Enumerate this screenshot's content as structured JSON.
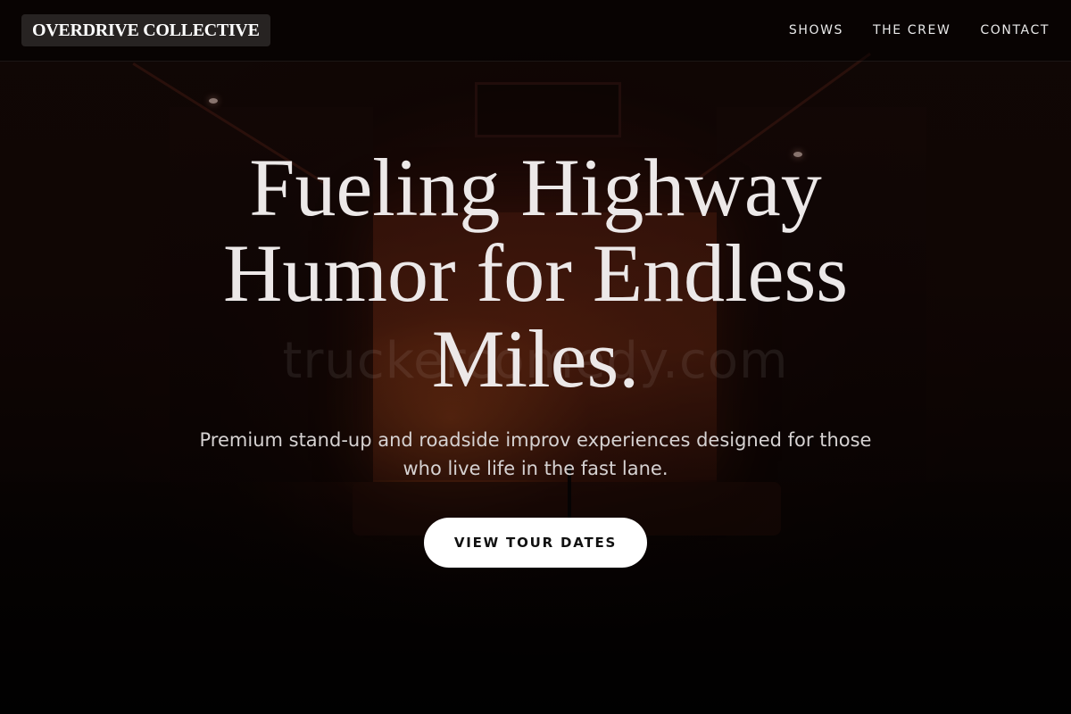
{
  "header": {
    "brand": "OVERDRIVE COLLECTIVE",
    "nav": [
      {
        "label": "SHOWS"
      },
      {
        "label": "THE CREW"
      },
      {
        "label": "CONTACT"
      }
    ]
  },
  "hero": {
    "title_lines": [
      "Fueling Highway",
      "Humor for Endless",
      "Miles."
    ],
    "subtitle_lines": [
      "Premium stand-up and roadside improv experiences designed for those",
      "who live life in the fast lane."
    ],
    "cta_label": "VIEW TOUR DATES",
    "watermark": "truckercomedy.com"
  },
  "colors": {
    "background": "#1a0b08",
    "stage_glow": "#e66e28",
    "text_primary": "#ece8e8",
    "cta_bg": "#ffffff",
    "cta_text": "#111111"
  }
}
